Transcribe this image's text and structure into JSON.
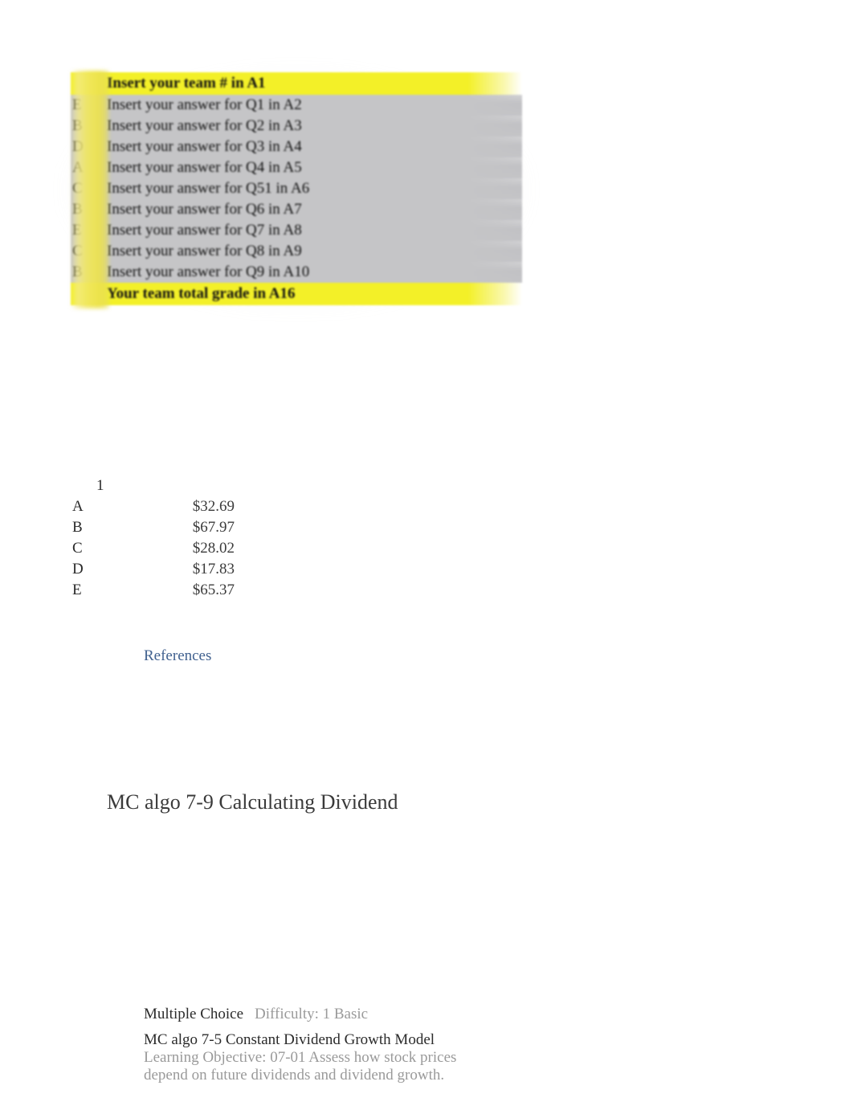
{
  "answer_key": {
    "rows": [
      {
        "letter": "",
        "text": "Insert your team # in A1",
        "style": "yellow"
      },
      {
        "letter": "E",
        "text": "Insert your answer for Q1 in A2",
        "style": "gray"
      },
      {
        "letter": "B",
        "text": "Insert your answer for Q2 in A3",
        "style": "gray"
      },
      {
        "letter": "D",
        "text": "Insert your answer for Q3 in A4",
        "style": "gray"
      },
      {
        "letter": "A",
        "text": "Insert your answer for Q4 in A5",
        "style": "gray"
      },
      {
        "letter": "C",
        "text": "Insert your answer for Q51 in A6",
        "style": "gray"
      },
      {
        "letter": "B",
        "text": "Insert your answer for Q6 in A7",
        "style": "gray"
      },
      {
        "letter": "E",
        "text": "Insert your answer for Q7 in A8",
        "style": "gray"
      },
      {
        "letter": "C",
        "text": "Insert your answer for Q8 in A9",
        "style": "gray"
      },
      {
        "letter": "B",
        "text": "Insert your answer for Q9 in A10",
        "style": "gray"
      },
      {
        "letter": "",
        "text": "Your team total grade in A16",
        "style": "yellow"
      }
    ],
    "highlight_color": "#f3f028",
    "body_color": "#c5c5c7"
  },
  "choices": {
    "header": "1",
    "rows": [
      {
        "letter": "A",
        "value": "$32.69"
      },
      {
        "letter": "B",
        "value": "$67.97"
      },
      {
        "letter": "C",
        "value": "$28.02"
      },
      {
        "letter": "D",
        "value": "$17.83"
      },
      {
        "letter": "E",
        "value": "$65.37"
      }
    ]
  },
  "references": {
    "label": "References",
    "color": "#41618f"
  },
  "question": {
    "title": "MC algo 7-9 Calculating Dividend"
  },
  "meta": {
    "question_type": "Multiple Choice",
    "difficulty": "Difficulty: 1 Basic",
    "algo_label": "MC algo 7-5 Constant Dividend Growth Model",
    "learning_objective": "Learning Objective: 07-01 Assess how stock prices depend on future dividends and dividend growth."
  }
}
